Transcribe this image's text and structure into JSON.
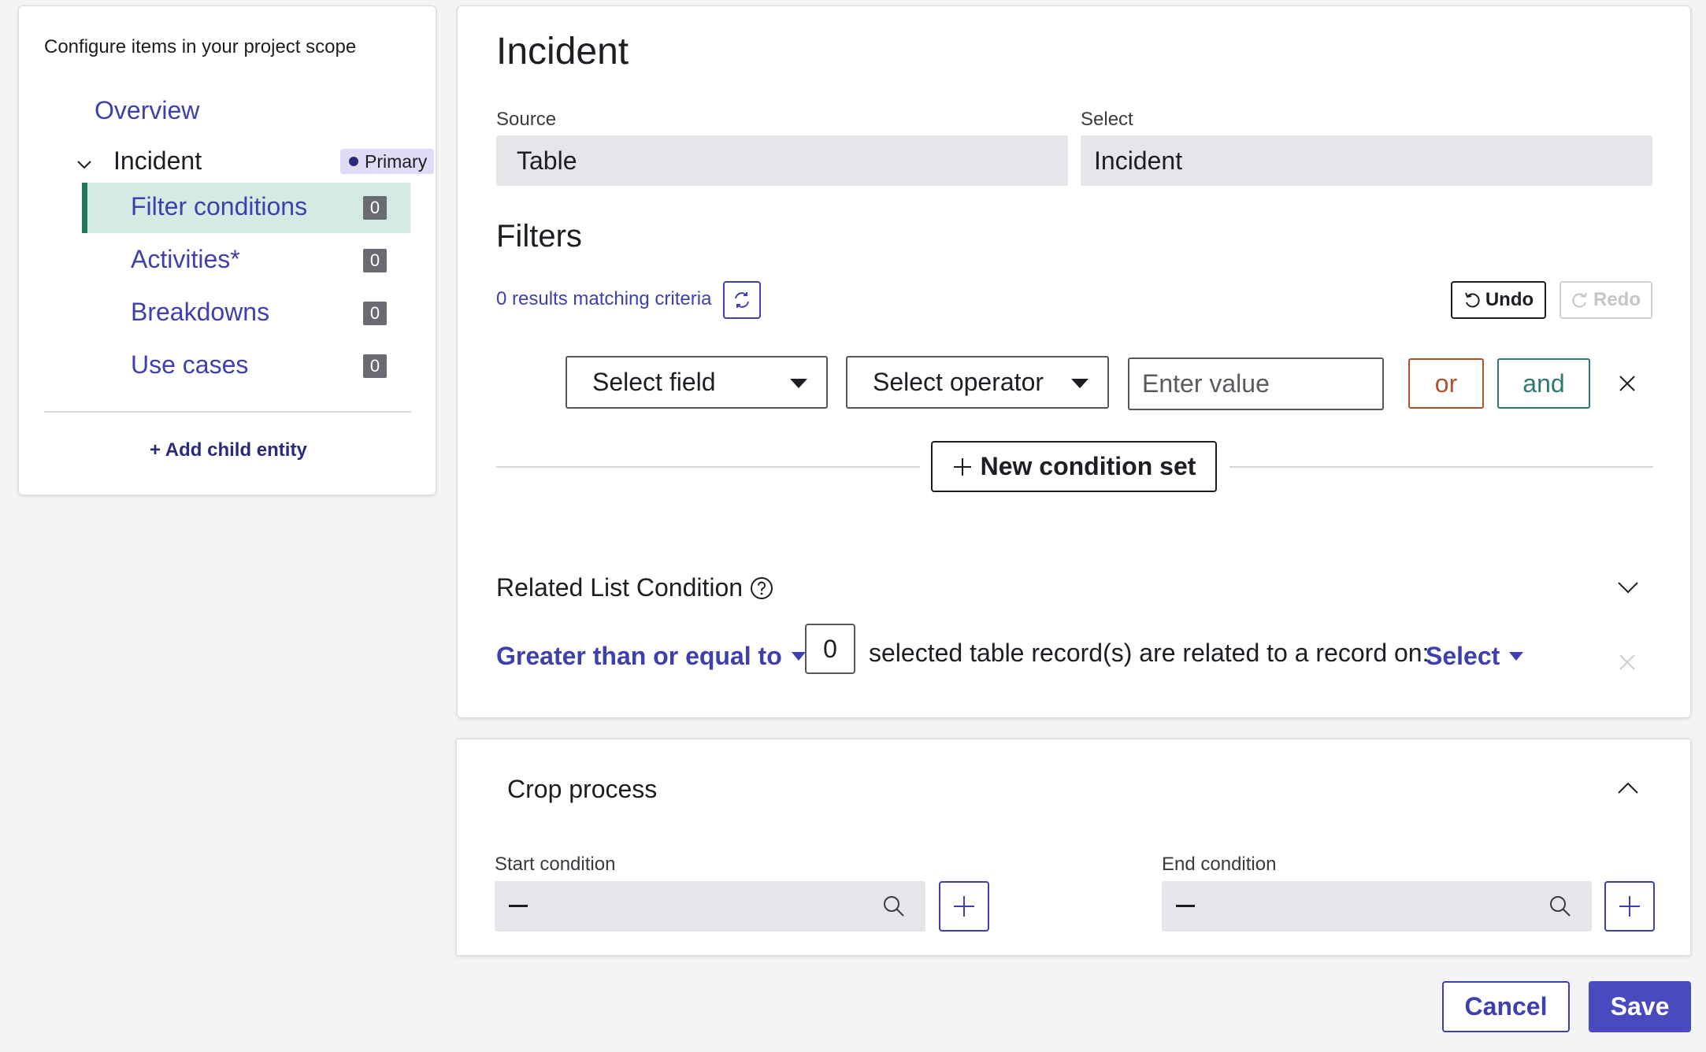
{
  "colors": {
    "accent": "#3e3fb0",
    "active_bg": "#d4ebe4",
    "active_bar": "#1f7a55",
    "or_color": "#b3502c",
    "and_color": "#2b7a74",
    "save_bg": "#4a4ac0"
  },
  "sidebar": {
    "title": "Configure items in your project scope",
    "overview": "Overview",
    "entity": {
      "label": "Incident",
      "badge": "Primary",
      "icon": "chevron-down-icon"
    },
    "items": [
      {
        "label": "Filter conditions",
        "count": "0",
        "active": true
      },
      {
        "label": "Activities*",
        "count": "0",
        "active": false
      },
      {
        "label": "Breakdowns",
        "count": "0",
        "active": false
      },
      {
        "label": "Use cases",
        "count": "0",
        "active": false
      }
    ],
    "add_child": "Add child entity"
  },
  "main": {
    "title": "Incident",
    "source": {
      "label": "Source",
      "value": "Table"
    },
    "select": {
      "label": "Select",
      "value": "Incident"
    },
    "filters_title": "Filters",
    "results": "0 results matching criteria",
    "undo": "Undo",
    "redo": "Redo",
    "condition": {
      "field": "Select field",
      "operator": "Select operator",
      "value_placeholder": "Enter value",
      "or": "or",
      "and": "and"
    },
    "new_condition_set": "New condition set",
    "related": {
      "title": "Related List Condition",
      "operator": "Greater than or equal to",
      "count": "0",
      "text": "selected table record(s) are related to a record on:",
      "select": "Select"
    }
  },
  "crop": {
    "title": "Crop process",
    "start_label": "Start condition",
    "start_value": "—",
    "end_label": "End condition",
    "end_value": "—"
  },
  "footer": {
    "cancel": "Cancel",
    "save": "Save"
  }
}
